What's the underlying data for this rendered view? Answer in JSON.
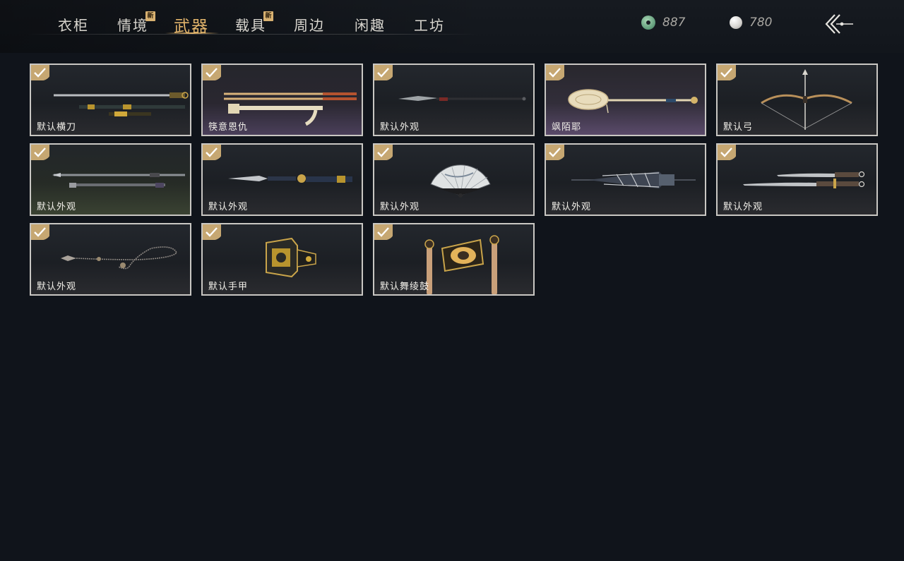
{
  "tabs": [
    {
      "label": "衣柜",
      "new": false,
      "active": false
    },
    {
      "label": "情境",
      "new": true,
      "active": false
    },
    {
      "label": "武器",
      "new": false,
      "active": true
    },
    {
      "label": "载具",
      "new": true,
      "active": false
    },
    {
      "label": "周边",
      "new": false,
      "active": false
    },
    {
      "label": "闲趣",
      "new": false,
      "active": false
    },
    {
      "label": "工坊",
      "new": false,
      "active": false
    }
  ],
  "new_badge_text": "新",
  "currency": {
    "jade": {
      "value": "887",
      "icon": "jade-coin-icon"
    },
    "pearl": {
      "value": "780",
      "icon": "pearl-icon"
    }
  },
  "accent_color": "#e2b46b",
  "items": [
    {
      "label": "默认横刀",
      "icon": "sword-with-scabbard",
      "owned": true
    },
    {
      "label": "筷意恩仇",
      "icon": "chopsticks-and-holder",
      "owned": true
    },
    {
      "label": "默认外观",
      "icon": "spear",
      "owned": true
    },
    {
      "label": "飒陌耶",
      "icon": "ornate-spade-staff",
      "owned": true
    },
    {
      "label": "默认弓",
      "icon": "bow-and-arrow",
      "owned": true
    },
    {
      "label": "默认外观",
      "icon": "twin-spears",
      "owned": true
    },
    {
      "label": "默认外观",
      "icon": "dagger-with-sheath",
      "owned": true
    },
    {
      "label": "默认外观",
      "icon": "folding-fan",
      "owned": true
    },
    {
      "label": "默认外观",
      "icon": "umbrella",
      "owned": true
    },
    {
      "label": "默认外观",
      "icon": "twin-blades",
      "owned": true
    },
    {
      "label": "默认外观",
      "icon": "rope-dart",
      "owned": true
    },
    {
      "label": "默认手甲",
      "icon": "gauntlet",
      "owned": true
    },
    {
      "label": "默认舞绫鼓",
      "icon": "drum-and-sticks",
      "owned": true
    }
  ]
}
